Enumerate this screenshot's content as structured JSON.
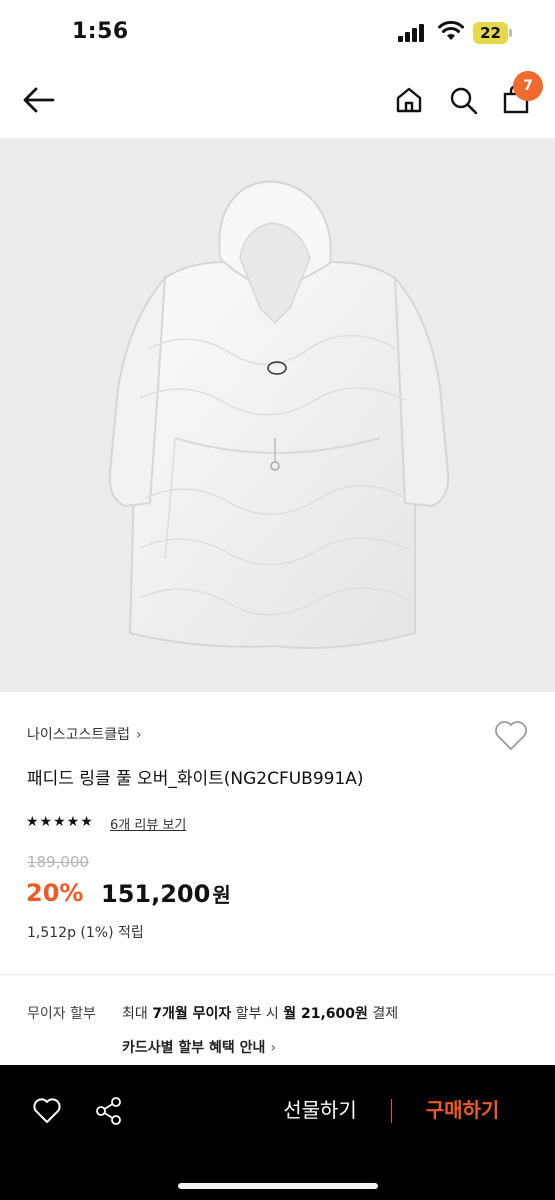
{
  "status_bar": {
    "time": "1:56",
    "battery": "22"
  },
  "header": {
    "cart_count": "7"
  },
  "product": {
    "brand": "나이스고스트클럽",
    "brand_chevron": "›",
    "title": "패디드 링클 풀 오버_화이트(NG2CFUB991A)",
    "rating_stars": "★★★★★",
    "review_link": "6개 리뷰 보기",
    "original_price": "189,000",
    "discount": "20%",
    "price": "151,200",
    "price_unit": "원",
    "points": "1,512p (1%) 적립"
  },
  "installment": {
    "label": "무이자 할부",
    "text_1": "최대 ",
    "months": "7개월 무이자",
    "text_2": " 할부 시 ",
    "monthly": "월 21,600원",
    "text_3": " 결제",
    "card_link": "카드사별 할부 혜택 안내",
    "card_chevron": "›"
  },
  "bottom_bar": {
    "gift_label": "선물하기",
    "buy_label": "구매하기"
  },
  "colors": {
    "accent": "#ee5a24",
    "badge": "#f26a2e",
    "image_bg": "#ececec",
    "bottom_bar": "#000000"
  },
  "icons": [
    "back-arrow-icon",
    "home-icon",
    "search-icon",
    "cart-icon",
    "heart-icon",
    "share-icon",
    "star-icon",
    "wifi-icon",
    "signal-icon",
    "battery-icon"
  ]
}
